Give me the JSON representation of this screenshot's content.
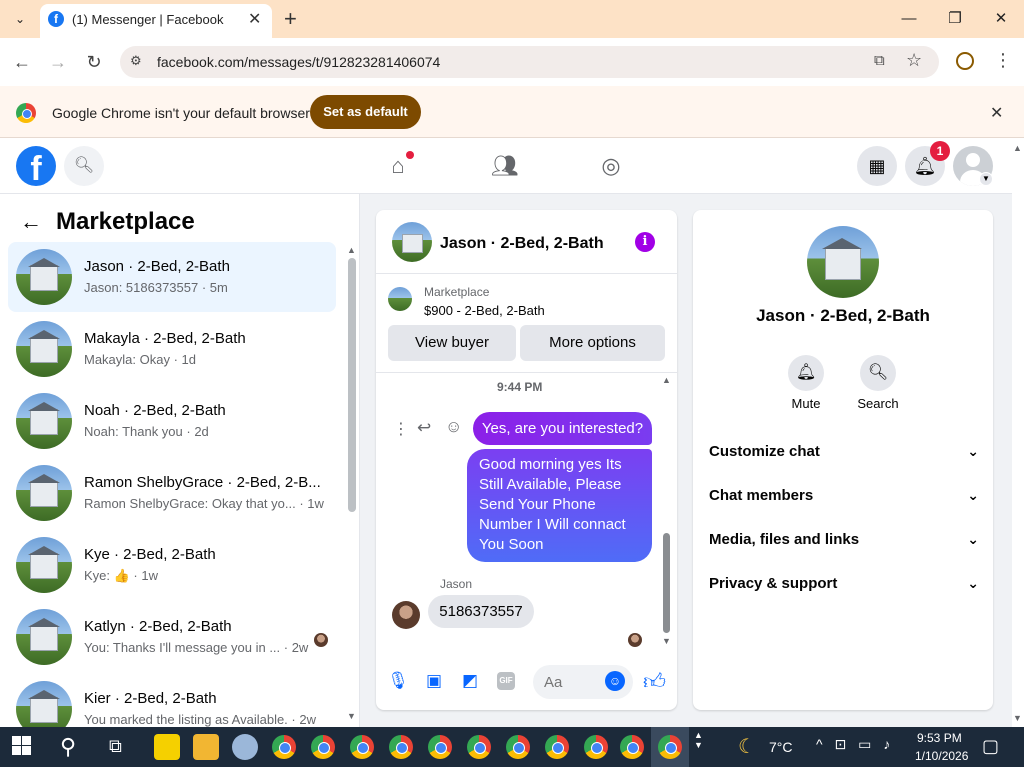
{
  "browser": {
    "tab_title": "(1) Messenger | Facebook",
    "tab_favicon": "f",
    "url": "facebook.com/messages/t/912823281406074",
    "infobar_text": "Google Chrome isn't your default browser",
    "set_default_label": "Set as default"
  },
  "fb": {
    "notification_count": "1",
    "brand_color": "#1877f2",
    "logo_letter": "f"
  },
  "sidebar": {
    "title": "Marketplace",
    "conversations": [
      {
        "name": "Jason · 2-Bed, 2-Bath",
        "preview": "Jason: 5186373557 · 5m",
        "active": true
      },
      {
        "name": "Makayla · 2-Bed, 2-Bath",
        "preview": "Makayla: Okay · 1d"
      },
      {
        "name": "Noah · 2-Bed, 2-Bath",
        "preview": "Noah: Thank you · 2d"
      },
      {
        "name": "Ramon ShelbyGrace · 2-Bed, 2-B...",
        "preview": "Ramon ShelbyGrace: Okay that yo...  · 1w"
      },
      {
        "name": "Kye · 2-Bed, 2-Bath",
        "preview": "Kye: 👍 · 1w"
      },
      {
        "name": "Katlyn · 2-Bed, 2-Bath",
        "preview": "You: Thanks I'll message you in ...  · 2w"
      },
      {
        "name": "Kier · 2-Bed, 2-Bath",
        "preview": "You marked the listing as Available. · 2w"
      }
    ]
  },
  "chat": {
    "title": "Jason · 2-Bed, 2-Bath",
    "listing_label": "Marketplace",
    "listing_price": "$900 - 2-Bed, 2-Bath",
    "view_buyer": "View buyer",
    "more_options": "More options",
    "time": "9:44 PM",
    "messages": [
      {
        "from": "me",
        "text": "Yes, are you interested?"
      },
      {
        "from": "me",
        "text": "Good morning yes Its Still Available, Please Send Your Phone Number I Will connact You Soon"
      },
      {
        "from": "Jason",
        "text": "5186373557"
      }
    ],
    "sender_name": "Jason",
    "input_placeholder": "Aa",
    "gif_label": "GIF"
  },
  "details": {
    "title": "Jason · 2-Bed, 2-Bath",
    "mute_label": "Mute",
    "search_label": "Search",
    "sections": [
      "Customize chat",
      "Chat members",
      "Media, files and links",
      "Privacy & support"
    ]
  },
  "taskbar": {
    "temperature": "7°C",
    "time": "9:53 PM",
    "date": "1/10/2026"
  }
}
